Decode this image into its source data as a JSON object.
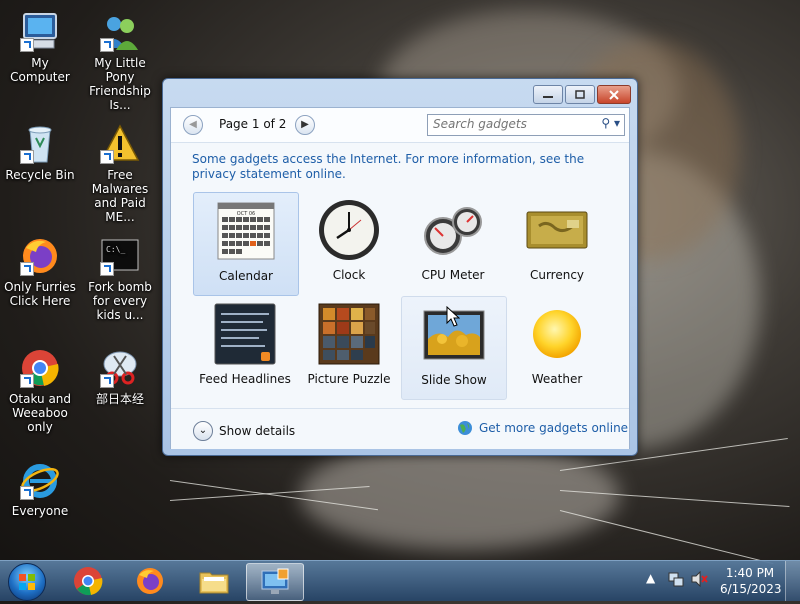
{
  "desktop": {
    "icons": [
      {
        "label": "My Computer"
      },
      {
        "label": "My Little Pony Friendship Is..."
      },
      {
        "label": "Recycle Bin"
      },
      {
        "label": "Free Malwares and Paid ME..."
      },
      {
        "label": "Only Furries Click Here"
      },
      {
        "label": "Fork bomb for every kids u..."
      },
      {
        "label": "Otaku and Weeaboo only"
      },
      {
        "label": "部日本经"
      },
      {
        "label": "Everyone"
      }
    ]
  },
  "gadgets_window": {
    "pager": {
      "label": "Page 1 of 2"
    },
    "search": {
      "placeholder": "Search gadgets"
    },
    "info_text": "Some gadgets access the Internet.  For more information, see the privacy statement online.",
    "gadgets": [
      {
        "label": "Calendar",
        "icon": "calendar-icon",
        "selected": true,
        "calendar_month": "OCT 06"
      },
      {
        "label": "Clock",
        "icon": "clock-icon"
      },
      {
        "label": "CPU Meter",
        "icon": "cpu-meter-icon"
      },
      {
        "label": "Currency",
        "icon": "currency-icon"
      },
      {
        "label": "Feed Headlines",
        "icon": "feed-headlines-icon"
      },
      {
        "label": "Picture Puzzle",
        "icon": "picture-puzzle-icon"
      },
      {
        "label": "Slide Show",
        "icon": "slide-show-icon",
        "hovered": true
      },
      {
        "label": "Weather",
        "icon": "weather-icon"
      }
    ],
    "footer": {
      "show_details": "Show details",
      "get_more": "Get more gadgets online"
    }
  },
  "taskbar": {
    "pinned": [
      "start-orb",
      "chrome-icon",
      "firefox-icon",
      "file-explorer-icon",
      "gadgets-icon"
    ],
    "clock": {
      "time": "1:40 PM",
      "date": "6/15/2023"
    }
  },
  "colors": {
    "link": "#1e5ea8",
    "window_frame": "#aac4e5",
    "close_button": "#c8452b"
  }
}
